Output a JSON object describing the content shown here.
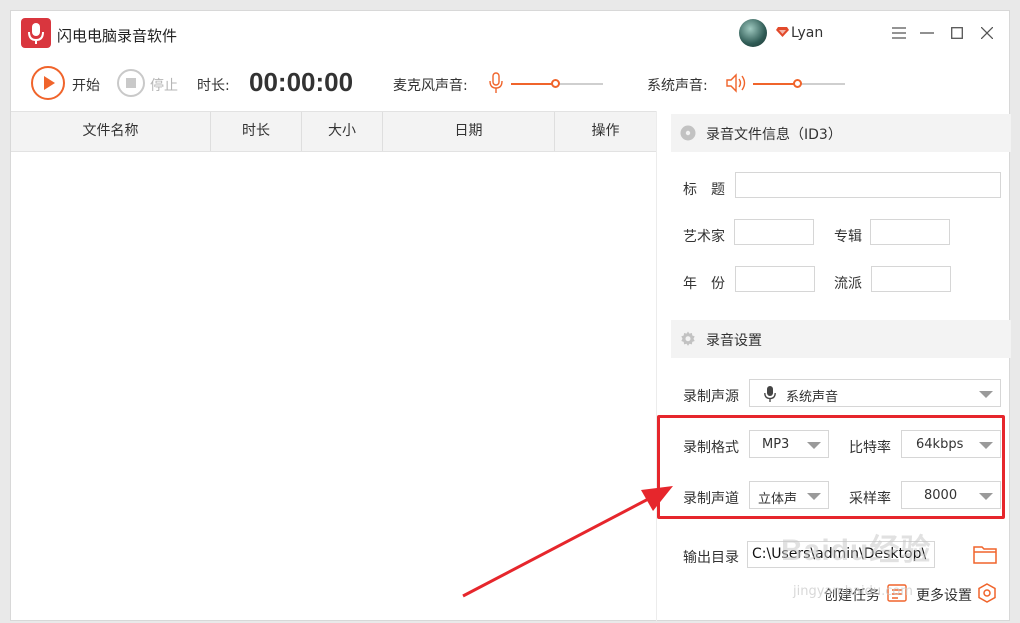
{
  "app": {
    "title": "闪电电脑录音软件",
    "username": "Lyan"
  },
  "colors": {
    "accent": "#f0642b",
    "highlight": "#e6262c",
    "brand": "#d9363e"
  },
  "toolbar": {
    "start_label": "开始",
    "stop_label": "停止",
    "duration_label": "时长:",
    "timer": "00:00:00",
    "mic_label": "麦克风声音:",
    "mic_level": 0.48,
    "system_label": "系统声音:",
    "system_level": 0.48
  },
  "table": {
    "columns": [
      "文件名称",
      "时长",
      "大小",
      "日期",
      "操作"
    ],
    "rows": []
  },
  "id3": {
    "title": "录音文件信息（ID3）",
    "title_label": "标　题",
    "title_value": "",
    "artist_label": "艺术家",
    "artist_value": "",
    "album_label": "专辑",
    "album_value": "",
    "year_label": "年　份",
    "year_value": "",
    "genre_label": "流派",
    "genre_value": ""
  },
  "settings": {
    "title": "录音设置",
    "source_label": "录制声源",
    "source_value": "系统声音",
    "format_label": "录制格式",
    "format_value": "MP3",
    "bitrate_label": "比特率",
    "bitrate_value": "64kbps",
    "channel_label": "录制声道",
    "channel_value": "立体声",
    "samplerate_label": "采样率",
    "samplerate_value": "8000"
  },
  "output": {
    "label": "输出目录",
    "path": "C:\\Users\\admin\\Desktop\\"
  },
  "footer": {
    "create_task": "创建任务",
    "more_settings": "更多设置"
  },
  "watermark": {
    "main": "Baidu经验",
    "sub": "jingyan.baidu.com"
  }
}
